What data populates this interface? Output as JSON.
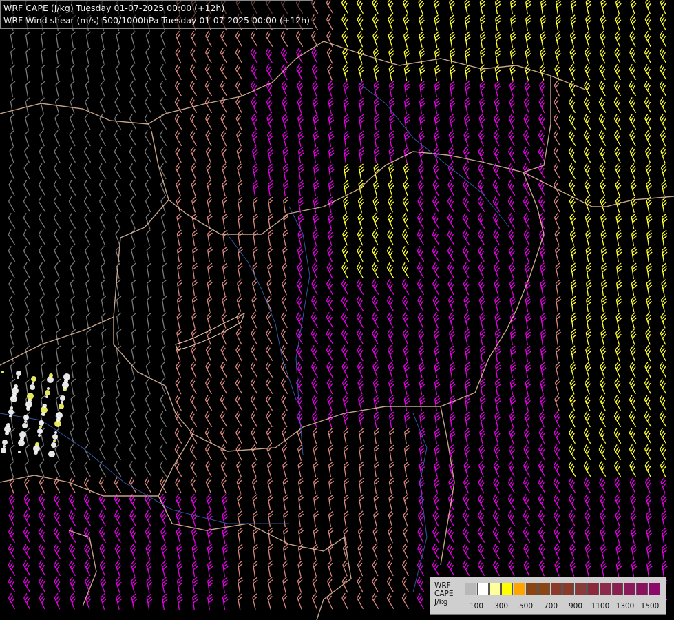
{
  "titles": {
    "cape": "WRF CAPE (J/kg) Tuesday 01-07-2025 00:00 (+12h)",
    "shear": "WRF Wind shear (m/s) 500/1000hPa Tuesday 01-07-2025 00:00 (+12h)"
  },
  "legend": {
    "line1": "WRF",
    "line2": "CAPE",
    "line3": "J/kg",
    "colors": [
      "#b8b8b8",
      "#ffffff",
      "#ffff99",
      "#ffff00",
      "#ffa500",
      "#8b4513",
      "#8b4513",
      "#8b3a2a",
      "#8b3a2a",
      "#8b3a3a",
      "#8b2a3a",
      "#8b2a4a",
      "#8b2050",
      "#8b1a5a",
      "#8b1060",
      "#8b0a6a"
    ],
    "tick_labels": [
      "100",
      "300",
      "500",
      "700",
      "900",
      "1100",
      "1300",
      "1500"
    ]
  },
  "colors": {
    "border": "#e8c0a0",
    "river": "#3a5fae",
    "barb_low": "#7a7a7a",
    "barb_mid": "#d98880",
    "barb_high": "#e600e6",
    "barb_max": "#ffff33"
  }
}
